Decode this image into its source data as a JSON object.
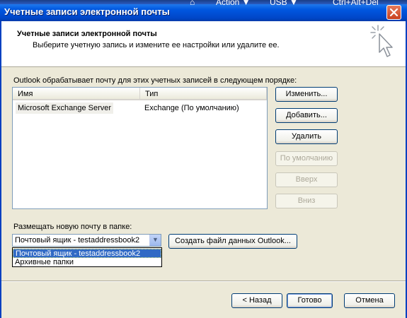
{
  "window": {
    "title": "Учетные записи электронной почты",
    "vm_menu": [
      "Action ▼",
      "USB ▼",
      "Ctrl+Alt+Del"
    ]
  },
  "header": {
    "title": "Учетные записи электронной почты",
    "subtitle": "Выберите учетную запись и измените ее настройки или удалите ее."
  },
  "accounts": {
    "intro": "Outlook обрабатывает почту для этих учетных записей в следующем порядке:",
    "columns": [
      "Имя",
      "Тип"
    ],
    "rows": [
      {
        "name": "Microsoft Exchange Server",
        "type": "Exchange (По умолчанию)"
      }
    ]
  },
  "side_buttons": {
    "change": "Изменить...",
    "add": "Добавить...",
    "delete": "Удалить",
    "default": "По умолчанию",
    "up": "Вверх",
    "down": "Вниз"
  },
  "delivery": {
    "label": "Размещать новую почту в папке:",
    "selected": "Почтовый ящик - testaddressbook2",
    "options": [
      "Почтовый ящик - testaddressbook2",
      "Архивные папки"
    ],
    "create_data_file": "Создать файл данных Outlook..."
  },
  "footer": {
    "back": "< Назад",
    "finish": "Готово",
    "cancel": "Отмена"
  }
}
